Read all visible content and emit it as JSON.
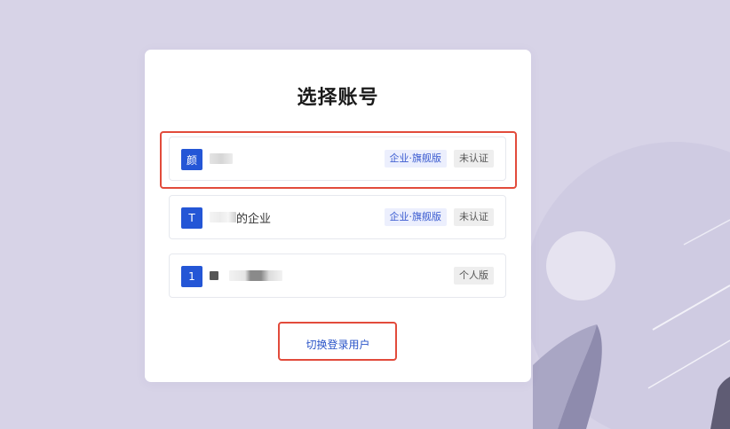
{
  "title": "选择账号",
  "accounts": [
    {
      "avatar_letter": "颜",
      "tags": [
        "企业·旗舰版",
        "未认证"
      ]
    },
    {
      "avatar_letter": "T",
      "name_suffix": "的企业",
      "tags": [
        "企业·旗舰版",
        "未认证"
      ]
    },
    {
      "avatar_letter": "1",
      "tags": [
        "个人版"
      ]
    }
  ],
  "switch_user_label": "切换登录用户",
  "colors": {
    "background": "#d7d3e7",
    "accent": "#2456d6",
    "highlight": "#e24b3b"
  }
}
